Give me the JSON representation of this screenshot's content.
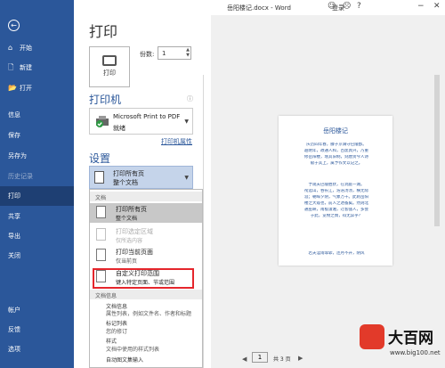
{
  "window": {
    "title": "岳阳楼记.docx - Word",
    "login": "登录",
    "icons": [
      "smile-icon",
      "frown-icon",
      "help-icon",
      "minimize-icon",
      "close-icon"
    ]
  },
  "sidebar": {
    "back_icon": "←",
    "items": [
      {
        "label": "开始",
        "icon": "⌂"
      },
      {
        "label": "新建",
        "icon": "🗋"
      },
      {
        "label": "打开",
        "icon": "📂"
      },
      {
        "label": "信息"
      },
      {
        "label": "保存"
      },
      {
        "label": "另存为"
      },
      {
        "label": "历史记录"
      },
      {
        "label": "打印"
      },
      {
        "label": "共享"
      },
      {
        "label": "导出"
      },
      {
        "label": "关闭"
      },
      {
        "label": "帐户"
      },
      {
        "label": "反馈"
      },
      {
        "label": "选项"
      }
    ],
    "selected": "打印"
  },
  "print": {
    "heading": "打印",
    "button_label": "打印",
    "copies_label": "份数:",
    "copies_value": "1"
  },
  "printer": {
    "heading": "打印机",
    "name": "Microsoft Print to PDF",
    "status": "就绪",
    "properties_link": "打印机属性"
  },
  "settings": {
    "heading": "设置",
    "range_main": "打印所有页",
    "range_sub": "整个文档"
  },
  "menu": {
    "doc_header": "文档",
    "items": [
      {
        "t1": "打印所有页",
        "t2": "整个文档"
      },
      {
        "t1": "打印选定区域",
        "t2": "仅所选内容"
      },
      {
        "t1": "打印当前页面",
        "t2": "仅当前页"
      },
      {
        "t1": "自定义打印范围",
        "t2": "键入特定页面、节或范围"
      }
    ],
    "info_header": "文档信息",
    "info_items": [
      "文档信息",
      "属性列表，例如文件名、作者和标题",
      "标记列表",
      "您的修订",
      "样式",
      "文档中使用的样式列表",
      "自动图文集输入"
    ]
  },
  "preview": {
    "page_title": "岳阳楼记",
    "lines": [
      "庆历四年春，滕子京谪守巴陵郡。",
      "越明年，政通人和，百废具兴，乃重",
      "修岳阳楼，增其旧制，刻唐贤今人诗",
      "赋于其上，属予作文以记之。",
      "",
      "予观夫巴陵胜状，在洞庭一湖。",
      "衔远山，吞长江，浩浩汤汤，横无际",
      "涯；朝晖夕阴，气象万千。此则岳阳",
      "楼之大观也，前人之述备矣。然则北",
      "通巫峡，南极潇湘，迁客骚人，多会",
      "于此，览物之情，得无异乎？",
      "",
      "若夫淫雨霏霏，连月不开，阴风"
    ],
    "page_current": "1",
    "page_total": "共 3 页"
  },
  "watermark": {
    "title": "大百网",
    "url": "www.big100.net"
  }
}
